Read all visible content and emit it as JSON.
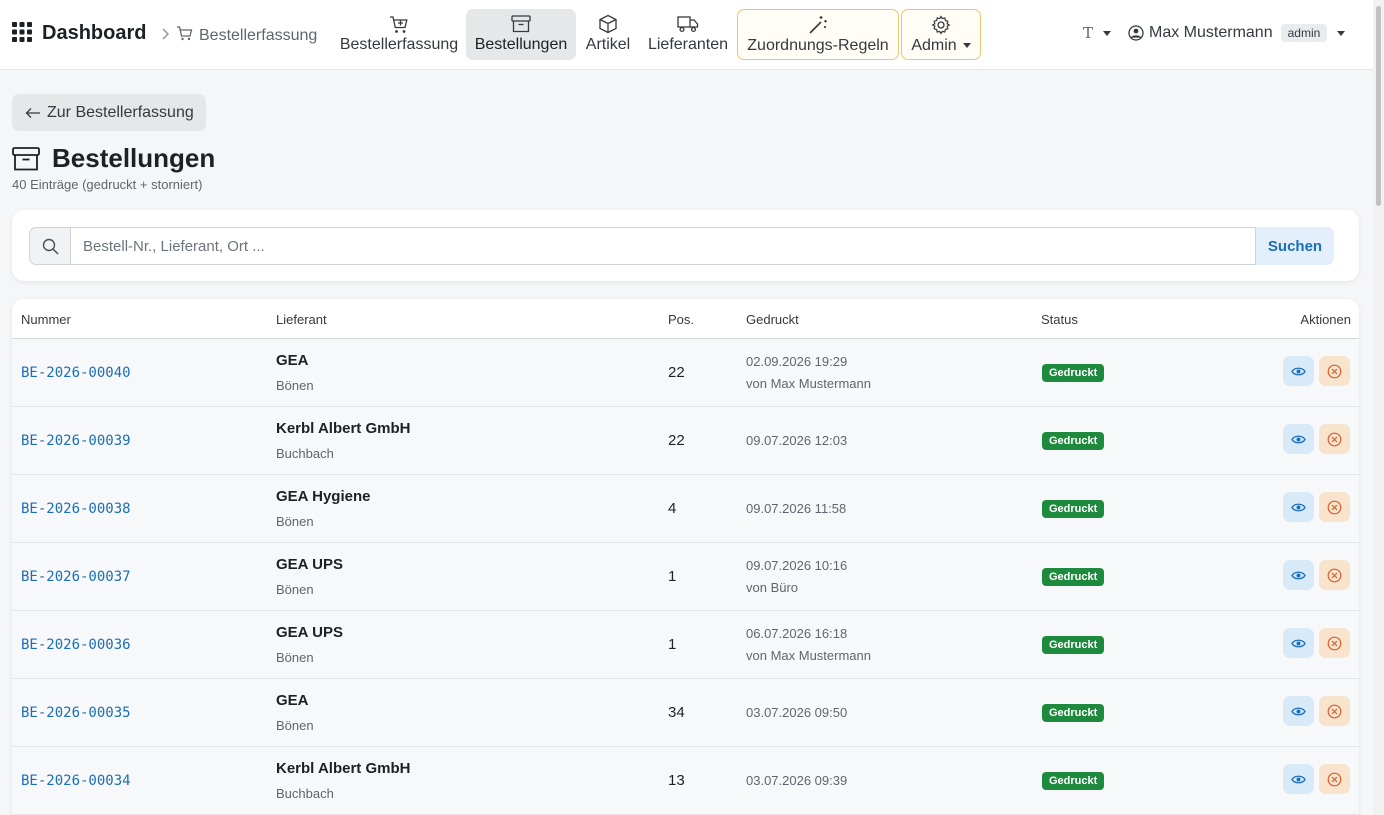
{
  "nav": {
    "brand": "Dashboard",
    "breadcrumb": "Bestellerfassung",
    "items": [
      {
        "label": "Bestellerfassung",
        "icon": "cart-plus-icon"
      },
      {
        "label": "Bestellungen",
        "icon": "archive-icon",
        "active": true
      },
      {
        "label": "Artikel",
        "icon": "box-icon"
      },
      {
        "label": "Lieferanten",
        "icon": "truck-icon"
      },
      {
        "label": "Zuordnungs-Regeln",
        "icon": "magic-wand-icon",
        "highlight": true
      },
      {
        "label": "Admin",
        "icon": "gear-icon",
        "highlight": true,
        "dropdown": true
      }
    ],
    "theme_label": "T",
    "user_name": "Max Mustermann",
    "user_role": "admin"
  },
  "back_button": "Zur Bestellerfassung",
  "page": {
    "title": "Bestellungen",
    "subtitle": "40 Einträge (gedruckt + storniert)"
  },
  "search": {
    "placeholder": "Bestell-Nr., Lieferant, Ort ...",
    "value": "",
    "button": "Suchen"
  },
  "table": {
    "headers": {
      "nummer": "Nummer",
      "lieferant": "Lieferant",
      "pos": "Pos.",
      "gedruckt": "Gedruckt",
      "status": "Status",
      "aktionen": "Aktionen"
    },
    "rows": [
      {
        "nummer": "BE-2026-00040",
        "lieferant": "GEA",
        "ort": "Bönen",
        "pos": "22",
        "datum": "02.09.2026 19:29",
        "von": "von Max Mustermann",
        "status": "Gedruckt"
      },
      {
        "nummer": "BE-2026-00039",
        "lieferant": "Kerbl Albert GmbH",
        "ort": "Buchbach",
        "pos": "22",
        "datum": "09.07.2026 12:03",
        "von": "",
        "status": "Gedruckt"
      },
      {
        "nummer": "BE-2026-00038",
        "lieferant": "GEA Hygiene",
        "ort": "Bönen",
        "pos": "4",
        "datum": "09.07.2026 11:58",
        "von": "",
        "status": "Gedruckt"
      },
      {
        "nummer": "BE-2026-00037",
        "lieferant": "GEA UPS",
        "ort": "Bönen",
        "pos": "1",
        "datum": "09.07.2026 10:16",
        "von": "von Büro",
        "status": "Gedruckt"
      },
      {
        "nummer": "BE-2026-00036",
        "lieferant": "GEA UPS",
        "ort": "Bönen",
        "pos": "1",
        "datum": "06.07.2026 16:18",
        "von": "von Max Mustermann",
        "status": "Gedruckt"
      },
      {
        "nummer": "BE-2026-00035",
        "lieferant": "GEA",
        "ort": "Bönen",
        "pos": "34",
        "datum": "03.07.2026 09:50",
        "von": "",
        "status": "Gedruckt"
      },
      {
        "nummer": "BE-2026-00034",
        "lieferant": "Kerbl Albert GmbH",
        "ort": "Buchbach",
        "pos": "13",
        "datum": "03.07.2026 09:39",
        "von": "",
        "status": "Gedruckt"
      }
    ]
  },
  "colors": {
    "accent": "#1a6fb5",
    "status_green": "#1e8a3e",
    "highlight_border": "#f2c46d"
  }
}
